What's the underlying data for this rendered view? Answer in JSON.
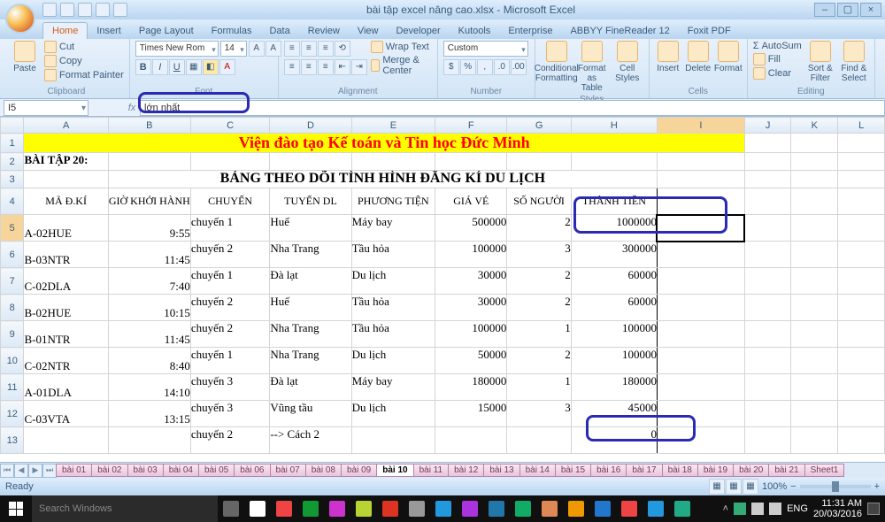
{
  "window": {
    "title": "bài tập excel nâng cao.xlsx - Microsoft Excel"
  },
  "ribbon_tabs": [
    "Home",
    "Insert",
    "Page Layout",
    "Formulas",
    "Data",
    "Review",
    "View",
    "Developer",
    "Kutools",
    "Enterprise",
    "ABBYY FineReader 12",
    "Foxit PDF"
  ],
  "ribbon": {
    "clipboard": {
      "paste": "Paste",
      "cut": "Cut",
      "copy": "Copy",
      "fp": "Format Painter",
      "label": "Clipboard"
    },
    "font": {
      "name": "Times New Rom",
      "size": "14",
      "label": "Font"
    },
    "alignment": {
      "wrap": "Wrap Text",
      "merge": "Merge & Center",
      "label": "Alignment"
    },
    "number": {
      "format": "Custom",
      "label": "Number"
    },
    "styles": {
      "cf": "Conditional Formatting",
      "fat": "Format as Table",
      "cs": "Cell Styles",
      "label": "Styles"
    },
    "cells": {
      "ins": "Insert",
      "del": "Delete",
      "fmt": "Format",
      "label": "Cells"
    },
    "editing": {
      "as": "AutoSum",
      "fill": "Fill",
      "clr": "Clear",
      "sort": "Sort & Filter",
      "find": "Find & Select",
      "label": "Editing"
    }
  },
  "namebox": "I5",
  "formula": "lớn nhất",
  "cols": [
    "A",
    "B",
    "C",
    "D",
    "E",
    "F",
    "G",
    "H",
    "I",
    "J",
    "K",
    "L"
  ],
  "row_nums": [
    1,
    2,
    3,
    4,
    5,
    6,
    7,
    8,
    9,
    10,
    11,
    12,
    13
  ],
  "banner": "Viện đào tạo Kế toán và Tin học Đức Minh",
  "row2": "BÀI TẬP 20:",
  "row3": "BẢNG THEO DÕI TÌNH HÌNH ĐĂNG KÍ DU LỊCH",
  "headers": {
    "A": "MÃ Đ.KÍ",
    "B": "GIỜ KHỞI HÀNH",
    "C": "CHUYẾN",
    "D": "TUYẾN DL",
    "E": "PHƯƠNG TIỆN",
    "F": "GIÁ VÉ",
    "G": "SỐ NGƯỜI",
    "H": "THÀNH TIỀN"
  },
  "rows": [
    {
      "a": "A-02HUE",
      "b": "9:55",
      "c": "chuyến 1",
      "d": "Huế",
      "e": "Máy bay",
      "f": "500000",
      "g": "2",
      "h": "1000000"
    },
    {
      "a": "B-03NTR",
      "b": "11:45",
      "c": "chuyến 2",
      "d": "Nha Trang",
      "e": "Tầu hỏa",
      "f": "100000",
      "g": "3",
      "h": "300000"
    },
    {
      "a": "C-02DLA",
      "b": "7:40",
      "c": "chuyến 1",
      "d": "Đà lạt",
      "e": "Du lịch",
      "f": "30000",
      "g": "2",
      "h": "60000"
    },
    {
      "a": "B-02HUE",
      "b": "10:15",
      "c": "chuyến 2",
      "d": "Huế",
      "e": "Tầu hỏa",
      "f": "30000",
      "g": "2",
      "h": "60000"
    },
    {
      "a": "B-01NTR",
      "b": "11:45",
      "c": "chuyến 2",
      "d": "Nha Trang",
      "e": "Tầu hỏa",
      "f": "100000",
      "g": "1",
      "h": "100000"
    },
    {
      "a": "C-02NTR",
      "b": "8:40",
      "c": "chuyến 1",
      "d": "Nha Trang",
      "e": "Du lịch",
      "f": "50000",
      "g": "2",
      "h": "100000"
    },
    {
      "a": "A-01DLA",
      "b": "14:10",
      "c": "chuyến 3",
      "d": "Đà lạt",
      "e": "Máy bay",
      "f": "180000",
      "g": "1",
      "h": "180000"
    },
    {
      "a": "C-03VTA",
      "b": "13:15",
      "c": "chuyến 3",
      "d": "Vũng tầu",
      "e": "Du lịch",
      "f": "15000",
      "g": "3",
      "h": "45000"
    },
    {
      "a": "",
      "b": "",
      "c": "chuyến 2",
      "d": " --> Cách 2",
      "e": "",
      "f": "",
      "g": "",
      "h": "0"
    }
  ],
  "sheets": [
    "bài 01",
    "bài 02",
    "bài 03",
    "bài 04",
    "bài 05",
    "bài 06",
    "bài 07",
    "bài 08",
    "bài 09",
    "bài 10",
    "bài 11",
    "bài 12",
    "bài 13",
    "bài 14",
    "bài 15",
    "bài 16",
    "bài 17",
    "bài 18",
    "bài 19",
    "bài 20",
    "bài 21",
    "Sheet1"
  ],
  "active_sheet": 9,
  "status": "Ready",
  "zoom": "100%",
  "taskbar": {
    "search": "Search Windows",
    "lang": "ENG",
    "time": "11:31 AM",
    "date": "20/03/2016"
  }
}
